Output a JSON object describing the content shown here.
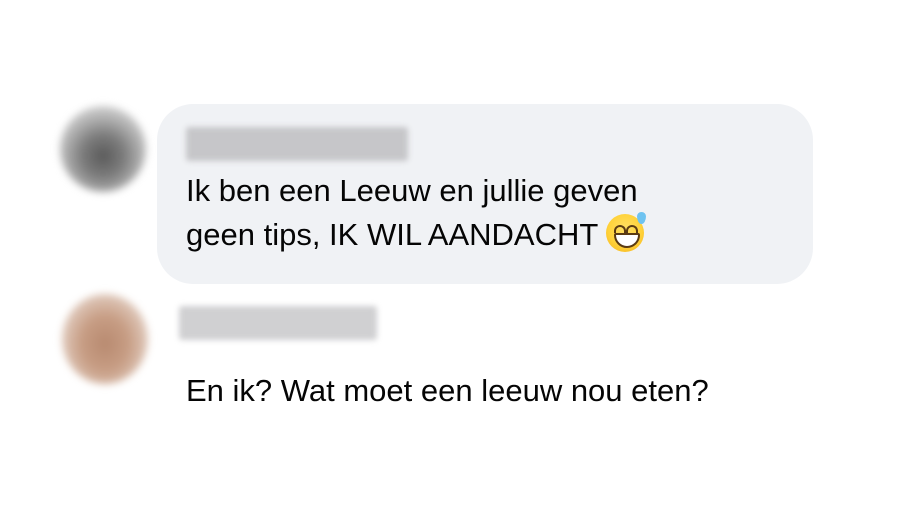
{
  "comments": [
    {
      "author_name_visible": false,
      "text": "Ik ben een Leeuw en jullie geven\ngeen tips, IK WIL AANDACHT",
      "emoji": "grinning-face-with-sweat"
    },
    {
      "author_name_visible": false,
      "text": "En ik? Wat moet een leeuw nou eten?"
    }
  ],
  "colors": {
    "bubble_background": "#f0f2f5",
    "text": "#050505"
  }
}
